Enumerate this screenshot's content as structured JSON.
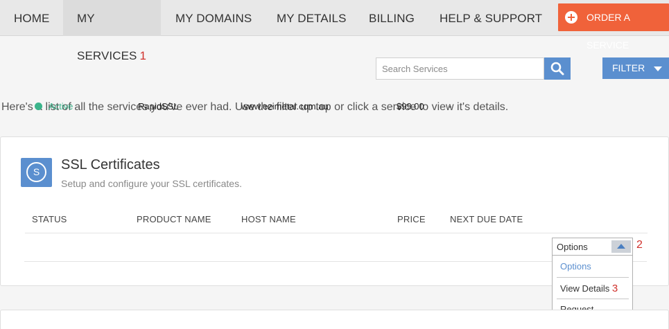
{
  "nav": {
    "items": [
      {
        "label": "HOME"
      },
      {
        "label": "MY SERVICES",
        "marker": "1"
      },
      {
        "label": "MY DOMAINS"
      },
      {
        "label": "MY DETAILS"
      },
      {
        "label": "BILLING"
      },
      {
        "label": "HELP & SUPPORT"
      }
    ],
    "order_label": "ORDER A SERVICE"
  },
  "search": {
    "placeholder": "Search Services",
    "value": ""
  },
  "filter": {
    "label": "FILTER"
  },
  "intro": "Here's a list of all the services you've ever had. Use the filter up top or click a service to view it's details.",
  "card": {
    "icon_letter": "S",
    "title": "SSL Certificates",
    "subtitle": "Setup and configure your SSL certificates.",
    "columns": [
      "STATUS",
      "PRODUCT NAME",
      "HOST NAME",
      "PRICE",
      "NEXT DUE DATE"
    ],
    "rows": [
      {
        "status": "Active",
        "product": "RapidSSL",
        "host": "www.ezimetal.com.au",
        "price": "$99.00",
        "due": "-"
      }
    ]
  },
  "options": {
    "label": "Options",
    "marker": "2",
    "menu": [
      {
        "label": "Options"
      },
      {
        "label": "View Details",
        "marker": "3"
      },
      {
        "label": "Request Cancellation"
      }
    ]
  },
  "colors": {
    "accent": "#5b8fcf",
    "order": "#f0623a",
    "active": "#3cb48b",
    "marker": "#d0302b"
  }
}
